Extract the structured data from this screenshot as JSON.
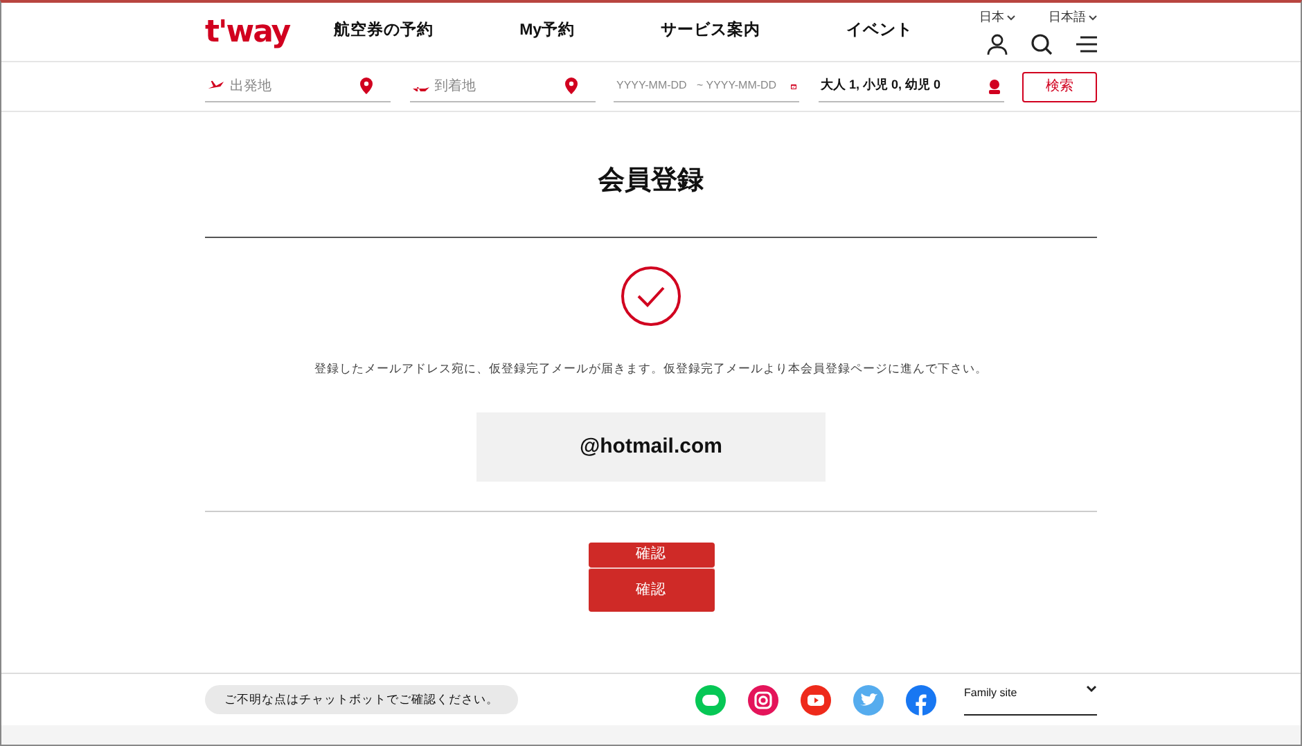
{
  "header": {
    "logo": "t'way",
    "nav": [
      "航空券の予約",
      "My予約",
      "サービス案内",
      "イベント"
    ],
    "country": "日本",
    "language": "日本語"
  },
  "search_bar": {
    "departure": {
      "placeholder": "出発地"
    },
    "arrival": {
      "placeholder": "到着地"
    },
    "dates": {
      "start_placeholder": "YYYY-MM-DD",
      "end_placeholder": "~ YYYY-MM-DD"
    },
    "passengers": "大人 1, 小児 0, 幼児 0",
    "search_button": "検索"
  },
  "main": {
    "title": "会員登録",
    "message": "登録したメールアドレス宛に、仮登録完了メールが届きます。仮登録完了メールより本会員登録ページに進んで下さい。",
    "email": "@hotmail.com",
    "buttons": [
      "確認",
      "確認"
    ]
  },
  "footer": {
    "chatbot": "ご不明な点はチャットボットでご確認ください。",
    "social": [
      {
        "kind": "line",
        "color": "#06c755"
      },
      {
        "kind": "instagram",
        "color": "#e4145a"
      },
      {
        "kind": "youtube",
        "color": "#ee2a1b"
      },
      {
        "kind": "twitter",
        "color": "#55acee"
      },
      {
        "kind": "facebook",
        "color": "#1877f2"
      }
    ],
    "family_site": "Family site"
  }
}
